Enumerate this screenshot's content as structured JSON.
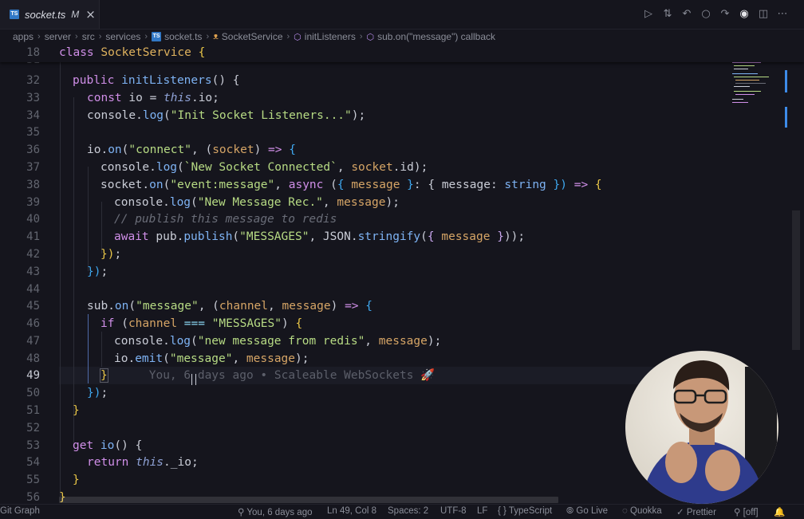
{
  "tab": {
    "file_name": "socket.ts",
    "modified": "M",
    "close": "×"
  },
  "breadcrumb": [
    "apps",
    "server",
    "src",
    "services",
    "socket.ts",
    "SocketService",
    "initListeners",
    "sub.on(\"message\") callback"
  ],
  "sticky_line": {
    "number": "18",
    "text": "class SocketService {"
  },
  "line_numbers": [
    "31",
    "32",
    "33",
    "34",
    "35",
    "36",
    "37",
    "38",
    "39",
    "40",
    "41",
    "42",
    "43",
    "44",
    "45",
    "46",
    "47",
    "48",
    "49",
    "50",
    "51",
    "52",
    "53",
    "54",
    "55",
    "56"
  ],
  "current_line": "49",
  "code": {
    "l32": [
      "public ",
      "initListeners",
      "() {"
    ],
    "l33": [
      "const ",
      "io = ",
      "this",
      ".io;"
    ],
    "l34": [
      "console.",
      "log",
      "(",
      "\"Init Socket Listeners...\"",
      ");"
    ],
    "l36": [
      "io.",
      "on",
      "(",
      "\"connect\"",
      ", (",
      "socket",
      ") ",
      "=>",
      " {"
    ],
    "l37": [
      "console.",
      "log",
      "(",
      "`New Socket Connected`",
      ", ",
      "socket",
      ".id);"
    ],
    "l38": [
      "socket.",
      "on",
      "(",
      "\"event:message\"",
      ", ",
      "async",
      " (",
      "{ ",
      "message",
      " }",
      ": { ",
      "message",
      ": ",
      "string",
      " })",
      " => ",
      "{"
    ],
    "l39": [
      "console.",
      "log",
      "(",
      "\"New Message Rec.\"",
      ", ",
      "message",
      ");"
    ],
    "l40": [
      "// publish this message to redis"
    ],
    "l41": [
      "await ",
      "pub.",
      "publish",
      "(",
      "\"MESSAGES\"",
      ", JSON.",
      "stringify",
      "(",
      "{ ",
      "message",
      " }",
      "));"
    ],
    "l42": [
      "})",
      ";"
    ],
    "l43": [
      "})",
      ";"
    ],
    "l45": [
      "sub.",
      "on",
      "(",
      "\"message\"",
      ", (",
      "channel",
      ", ",
      "message",
      ") ",
      "=>",
      " {"
    ],
    "l46": [
      "if",
      " (",
      "channel",
      " === ",
      "\"MESSAGES\"",
      ") ",
      "{"
    ],
    "l47": [
      "console.",
      "log",
      "(",
      "\"new message from redis\"",
      ", ",
      "message",
      ");"
    ],
    "l48": [
      "io.",
      "emit",
      "(",
      "\"message\"",
      ", ",
      "message",
      ");"
    ],
    "l49": [
      "}"
    ],
    "l49_blame": "You, 6 days ago • Scaleable WebSockets 🚀",
    "l50": [
      "})",
      ";"
    ],
    "l51": [
      "}"
    ],
    "l53": [
      "get ",
      "io",
      "() {"
    ],
    "l54": [
      "return ",
      "this",
      "._io;"
    ],
    "l55": [
      "}"
    ],
    "l56": [
      "}"
    ]
  },
  "status": {
    "git_graph": "Git Graph",
    "blame": "You, 6 days ago",
    "position": "Ln 49, Col 8",
    "spaces": "Spaces: 2",
    "encoding": "UTF-8",
    "eol": "LF",
    "language_braces": "{ }",
    "language": "TypeScript",
    "go_live": "Go Live",
    "quokka": "Quokka",
    "prettier": "Prettier",
    "off": "[off]"
  },
  "colors": {
    "ts_blue": "#3178c6",
    "keyword": "#d08fe8",
    "string": "#b7db84",
    "function": "#7eb3f4",
    "parameter": "#d6a566"
  }
}
